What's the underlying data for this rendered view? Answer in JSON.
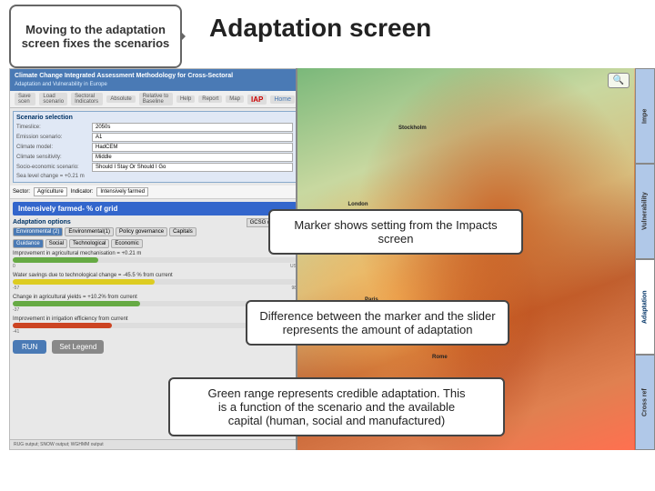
{
  "title": "Adaptation screen",
  "callout": {
    "text": "Moving to the adaptation screen fixes the scenarios"
  },
  "app": {
    "header": {
      "title": "Climate Change Integrated Assessment Methodology for Cross-Sectoral",
      "subtitle": "Adaptation and Vulnerability in Europe",
      "iap_label": "IAP",
      "home_label": "Home"
    },
    "nav": {
      "save_label": "Save scen",
      "load_label": "Load scenario",
      "indicators_label": "Sectoral Indicators",
      "absolute_label": "Absolute",
      "relative_label": "Relative to Baseline",
      "help_label": "Help",
      "report_label": "Report",
      "map_label": "Map"
    },
    "scenario": {
      "title": "Scenario selection",
      "timeslice_label": "Timeslice:",
      "timeslice_value": "2050s",
      "emission_label": "Emission scenario:",
      "emission_value": "A1",
      "climate_label": "Climate model:",
      "climate_value": "HadCEM",
      "sensitivity_label": "Climate sensitivity:",
      "sensitivity_value": "Middle",
      "socio_label": "Socio-economic scenario:",
      "socio_value": "Should I Stay Or Should I Go",
      "sea_level_label": "Sea level change = +0.21 m"
    },
    "sector_bar": {
      "sector_label": "Sector:",
      "sector_value": "Agriculture",
      "indicator_label": "Indicator:",
      "indicator_value": "Intensively farmed"
    },
    "intensively_label": "Intensively farmed- % of grid",
    "adaptation": {
      "title": "Adaptation options",
      "gcsg_label": "GCSG details ON",
      "tabs": [
        "Environmental (2)",
        "Environmental(1)",
        "Policy governance",
        "Capitals"
      ],
      "subtabs": [
        "Guidance",
        "Social",
        "Technological",
        "Economic"
      ],
      "sliders": [
        {
          "label": "Improvement in agricultural mechanisation = +0.21 m",
          "min": "0",
          "max": "US",
          "fill_pct": 30,
          "color": "green"
        },
        {
          "label": "Water savings due to technological change = -45.5 % from current",
          "min": "-57",
          "max": "98",
          "fill_pct": 50,
          "color": "yellow"
        },
        {
          "label": "Change in agricultural yields = +10.2% from current",
          "min": "-37",
          "max": "98",
          "fill_pct": 45,
          "color": "green"
        },
        {
          "label": "Improvement in irrigation efficiency from current",
          "min": "-41",
          "max": "",
          "fill_pct": 35,
          "color": "red"
        }
      ]
    },
    "run_button": "RUN",
    "legend_button": "Set Legend",
    "bottom_bar": "RUG output; SNOW output; WGHMM output"
  },
  "right_tabs": [
    "Impe",
    "Vulnerability",
    "Adaptation",
    "Cross ref"
  ],
  "annotations": {
    "marker": "Marker shows setting from the Impacts screen",
    "difference": "Difference between the marker and the slider\nrepresents the amount of adaptation",
    "green_range": "Green range represents credible adaptation. This\nis a function of the scenario and the available\ncapital (human, social and manufactured)"
  },
  "colors": {
    "accent_blue": "#4a7ab5",
    "callout_border": "#666",
    "annotation_border": "#444",
    "green": "#66aa44"
  }
}
